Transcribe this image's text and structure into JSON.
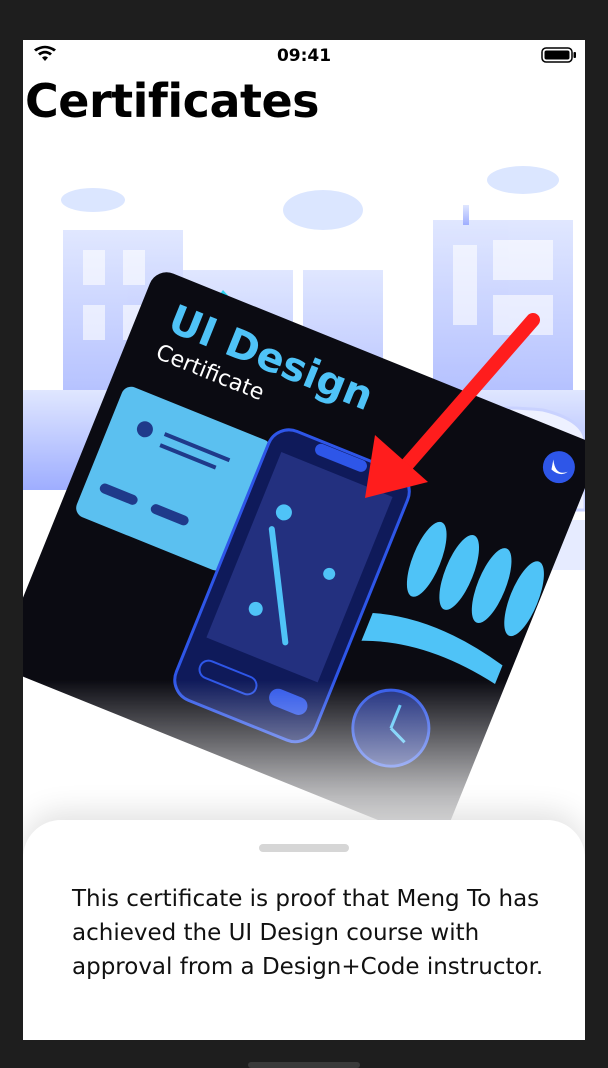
{
  "status_bar": {
    "time": "09:41",
    "wifi_icon": "wifi-icon",
    "battery_icon": "battery-icon"
  },
  "header": {
    "title": "Certificates"
  },
  "certificate": {
    "title": "UI Design",
    "subtitle": "Certificate",
    "badge_icon": "swift-logo-icon"
  },
  "annotation": {
    "arrow_color": "#ff1d1d"
  },
  "sheet": {
    "description": "This certificate is proof that Meng To has achieved the UI Design course with approval from a Design+Code instructor."
  },
  "colors": {
    "accent": "#4fc3f7",
    "card_bg": "#0b0b12",
    "city": "#aab8ff"
  }
}
